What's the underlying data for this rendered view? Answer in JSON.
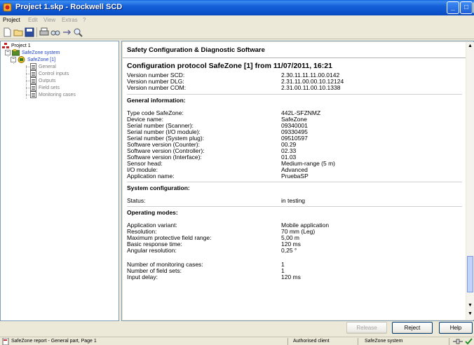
{
  "window": {
    "title": "Project 1.skp - Rockwell SCD"
  },
  "menu": [
    {
      "label": "Project",
      "enabled": true
    },
    {
      "label": "Edit",
      "enabled": false
    },
    {
      "label": "View",
      "enabled": false
    },
    {
      "label": "Extras",
      "enabled": false
    },
    {
      "label": "?",
      "enabled": false
    }
  ],
  "toolbar": {
    "buttons": [
      "new-file-icon",
      "open-folder-icon",
      "save-icon",
      "print-icon",
      "find-icon",
      "transfer-icon",
      "zoom-icon"
    ]
  },
  "tree": {
    "root": "Project 1",
    "system": "SafeZone system",
    "device": "SafeZone [1]",
    "children": [
      "General",
      "Control inputs",
      "Outputs",
      "Field sets",
      "Monitoring cases"
    ]
  },
  "report": {
    "header": "Safety Configuration & Diagnostic Software",
    "title": "Configuration protocol SafeZone [1] from 11/07/2011, 16:21",
    "versions": [
      {
        "k": "Version number SCD:",
        "v": "2.30.11.11.11.00.0142"
      },
      {
        "k": "Version number DLG:",
        "v": "2.31.11.00.00.10.12124"
      },
      {
        "k": "Version number COM:",
        "v": "2.31.00.11.00.10.1338"
      }
    ],
    "general_heading": "General information:",
    "general": [
      {
        "k": "Type code SafeZone:",
        "v": "442L-SFZNMZ"
      },
      {
        "k": "Device name:",
        "v": "SafeZone"
      },
      {
        "k": "Serial number (Scanner):",
        "v": "09340001"
      },
      {
        "k": "Serial number (I/O module):",
        "v": "09330495"
      },
      {
        "k": "Serial number (System plug):",
        "v": "09510597"
      },
      {
        "k": "Software version (Counter):",
        "v": "00.29"
      },
      {
        "k": "Software version (Controller):",
        "v": "02.33"
      },
      {
        "k": "Software version (Interface):",
        "v": "01.03"
      },
      {
        "k": "Sensor head:",
        "v": "Medium-range (5 m)"
      },
      {
        "k": "I/O module:",
        "v": "Advanced"
      },
      {
        "k": "Application name:",
        "v": "PruebaSP"
      }
    ],
    "system_heading": "System configuration:",
    "system": [
      {
        "k": "Status:",
        "v": "in testing"
      }
    ],
    "modes_heading": "Operating modes:",
    "modes": [
      {
        "k": "Application variant:",
        "v": "Mobile application"
      },
      {
        "k": "Resolution:",
        "v": "70 mm (Leg)"
      },
      {
        "k": "Maximum protective field range:",
        "v": "5,00 m"
      },
      {
        "k": "Basic response time:",
        "v": "120 ms"
      },
      {
        "k": "Angular resolution:",
        "v": "0,25 °"
      }
    ],
    "monitoring": [
      {
        "k": "Number of monitoring cases:",
        "v": "1"
      },
      {
        "k": "Number of field sets:",
        "v": "1"
      },
      {
        "k": "Input delay:",
        "v": "120 ms"
      }
    ]
  },
  "buttons": {
    "release": "Release",
    "reject": "Reject",
    "help": "Help"
  },
  "status": {
    "report": "SafeZone report - General part, Page 1",
    "client": "Authorised client",
    "system": "SafeZone system"
  },
  "colors": {
    "titlebar": "#0a4fc8",
    "tree_link": "#1a3fd0"
  }
}
